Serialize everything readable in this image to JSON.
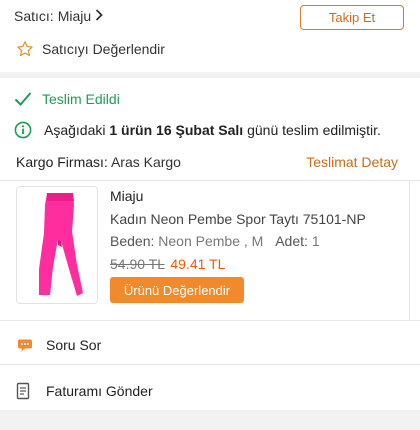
{
  "seller": {
    "label": "Satıcı:",
    "name": "Miaju",
    "follow_button": "Takip Et",
    "rate_label": "Satıcıyı Değerlendir"
  },
  "delivery": {
    "status": "Teslim Edildi",
    "info_prefix": "Aşağıdaki ",
    "info_bold": "1 ürün 16 Şubat Salı",
    "info_suffix": " günü teslim edilmiştir.",
    "cargo_label": "Kargo Firması:",
    "cargo_name": "Aras Kargo",
    "tracking_link": "Teslimat Detay"
  },
  "product": {
    "brand": "Miaju",
    "name": "Kadın Neon Pembe Spor Taytı 75101-NP",
    "size_label": "Beden:",
    "size_value": "Neon Pembe , M",
    "qty_label": "Adet:",
    "qty_value": "1",
    "old_price": "54.90 TL",
    "new_price": "49.41 TL",
    "review_button": "Ürünü Değerlendir",
    "image_color": "#ff2d9e"
  },
  "menu": [
    {
      "label": "Soru Sor",
      "icon": "chat-icon"
    },
    {
      "label": "Faturamı Gönder",
      "icon": "invoice-icon"
    }
  ],
  "colors": {
    "accent": "#f08a2c",
    "success": "#1f9d55"
  }
}
